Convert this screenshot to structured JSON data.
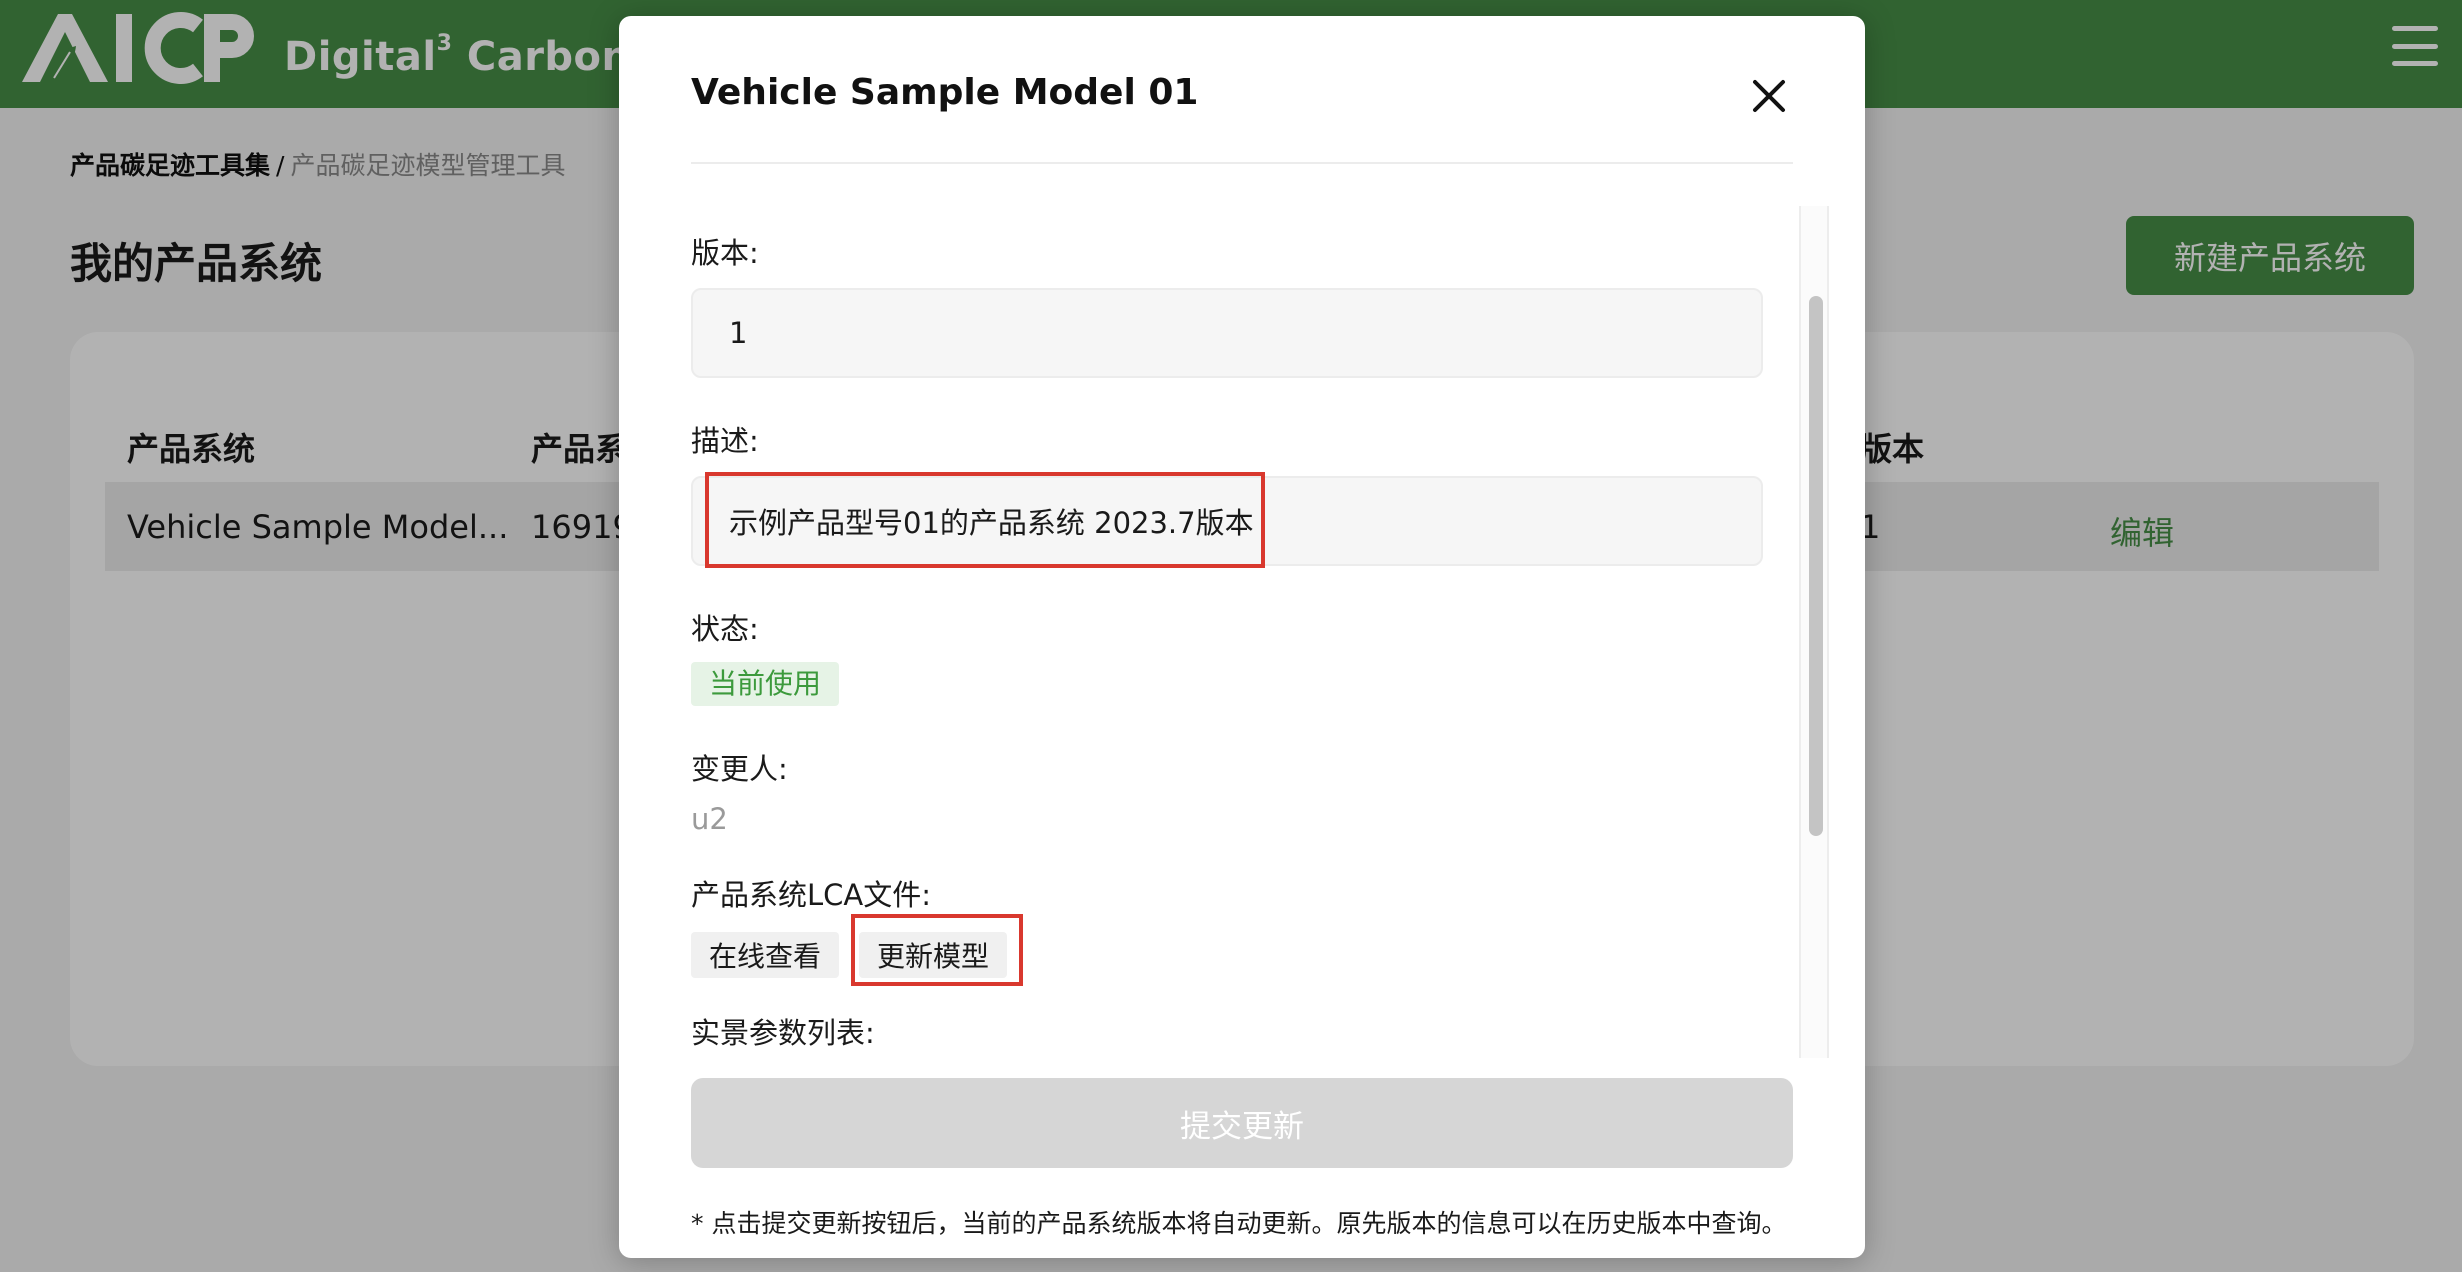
{
  "header": {
    "logo_text": "AICP",
    "brand_name": "Digital",
    "brand_superscript": "3",
    "brand_suffix": "Carbon"
  },
  "breadcrumb": {
    "root": "产品碳足迹工具集",
    "separator": "/",
    "current": "产品碳足迹模型管理工具"
  },
  "page": {
    "title": "我的产品系统",
    "new_button": "新建产品系统"
  },
  "table": {
    "columns": [
      "产品系统",
      "产品系",
      "版本"
    ],
    "rows": [
      {
        "name": "Vehicle Sample Model...",
        "id": "16919",
        "version": "1",
        "action": "编辑"
      }
    ]
  },
  "modal": {
    "title": "Vehicle Sample Model 01",
    "fields": {
      "version_label": "版本:",
      "version_value": "1",
      "description_label": "描述:",
      "description_value": "示例产品型号01的产品系统 2023.7版本",
      "status_label": "状态:",
      "status_value": "当前使用",
      "changer_label": "变更人:",
      "changer_value": "u2",
      "lca_file_label": "产品系统LCA文件:",
      "view_online_button": "在线查看",
      "update_model_button": "更新模型",
      "params_label": "实景参数列表:"
    },
    "submit_button": "提交更新",
    "footnote": "* 点击提交更新按钮后，当前的产品系统版本将自动更新。原先版本的信息可以在历史版本中查询。"
  },
  "colors": {
    "brand_green": "#478f47",
    "status_green": "#3c9a3c",
    "status_bg": "#e6f3e6",
    "highlight_red": "#d9382e",
    "submit_disabled": "#d6d6d6"
  },
  "icons": {
    "close": "close-icon",
    "menu": "hamburger-menu-icon",
    "logo": "leaf-logo-icon"
  }
}
